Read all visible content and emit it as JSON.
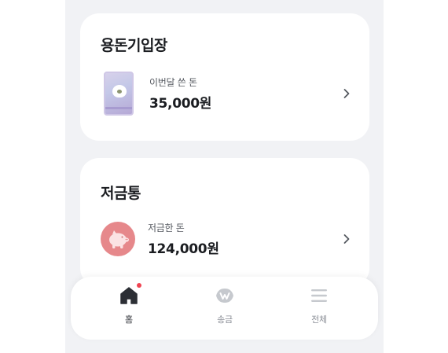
{
  "allowance": {
    "title": "용돈기입장",
    "label": "이번달 쓴 돈",
    "amount": "35,000원"
  },
  "piggy": {
    "title": "저금통",
    "label": "저금한 돈",
    "amount": "124,000원"
  },
  "tabbar": {
    "home_label": "홈",
    "send_label": "송금",
    "all_label": "전체",
    "home_has_badge": true
  },
  "colors": {
    "background": "#f1f2f5",
    "card": "#ffffff",
    "piggy_circle": "#e6888b",
    "badge": "#f04452",
    "text_primary": "#1b1d21",
    "text_secondary": "#54585f",
    "tab_inactive": "#c6c9ce"
  }
}
